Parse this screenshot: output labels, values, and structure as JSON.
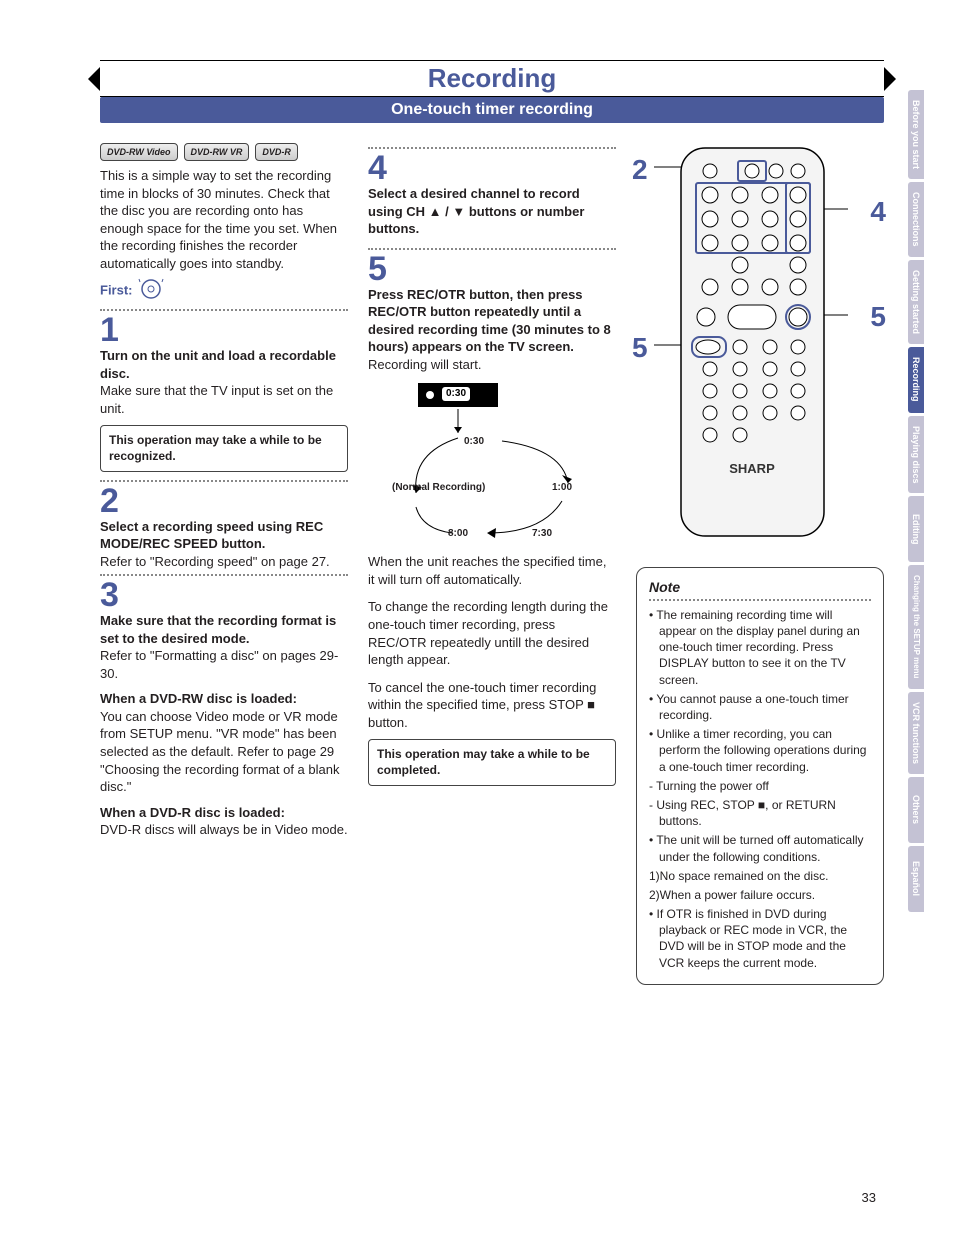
{
  "header": {
    "title": "Recording",
    "subtitle": "One-touch timer recording"
  },
  "badges": [
    "DVD-RW Video",
    "DVD-RW VR",
    "DVD-R"
  ],
  "intro": "This is a simple way to set the recording time in blocks of 30 minutes. Check that the disc you are recording onto has enough space for the time you set. When the recording finishes the recorder automatically goes into standby.",
  "first_label": "First:",
  "steps": {
    "s1": {
      "num": "1",
      "head": "Turn on the unit and load a recordable disc.",
      "body": "Make sure that the TV input is set on the unit.",
      "note": "This operation may take a while to be recognized."
    },
    "s2": {
      "num": "2",
      "head": "Select a recording speed using REC MODE/REC SPEED button.",
      "body": "Refer to \"Recording speed\" on page 27."
    },
    "s3": {
      "num": "3",
      "head": "Make sure that the recording format is set to the desired mode.",
      "body": "Refer to \"Formatting a disc\" on pages 29-30.",
      "rw_head": "When a DVD-RW disc is loaded:",
      "rw_body": "You can choose Video mode or VR mode from SETUP menu. \"VR mode\" has been selected as the default. Refer to page 29 \"Choosing the recording format of a blank disc.\"",
      "r_head": "When a DVD-R disc is loaded:",
      "r_body": "DVD-R discs will always be in Video mode."
    },
    "s4": {
      "num": "4",
      "head": "Select a desired channel to record using CH ▲ / ▼ buttons or number buttons."
    },
    "s5": {
      "num": "5",
      "head": "Press REC/OTR button, then press REC/OTR button repeatedly until a desired recording time (30 minutes to 8 hours) appears on the TV screen.",
      "body": "Recording will start."
    }
  },
  "diagram": {
    "osd": "0:30",
    "t030": "0:30",
    "normal": "(Normal Recording)",
    "t100": "1:00",
    "t800": "8:00",
    "t730": "7:30"
  },
  "after": {
    "p1": "When the unit reaches the specified time, it will turn off automatically.",
    "p2": "To change the recording length during the one-touch timer recording, press REC/OTR repeatedly untill the desired length appear.",
    "p3": "To cancel the one-touch timer recording within the specified time, press STOP ■ button.",
    "note": "This operation may take a while to be completed."
  },
  "callouts": {
    "c2": "2",
    "c4": "4",
    "c5a": "5",
    "c5b": "5"
  },
  "remote_brand": "SHARP",
  "note_box": {
    "hdr": "Note",
    "items": [
      "• The remaining recording time will appear on the display panel during an one-touch timer recording. Press DISPLAY button to see it on the TV screen.",
      "• You cannot pause a one-touch timer recording.",
      "• Unlike a timer recording, you can perform the following operations during a one-touch timer recording.",
      "  - Turning the power off",
      "  - Using REC, STOP ■, or RETURN buttons.",
      "• The unit will be turned off automatically under the following conditions.",
      "  1)No space remained on the disc.",
      "  2)When a power failure occurs.",
      "• If OTR is finished in DVD during playback or REC mode in VCR, the DVD will be in STOP mode and the VCR keeps the current mode."
    ]
  },
  "tabs": [
    "Before you start",
    "Connections",
    "Getting started",
    "Recording",
    "Playing discs",
    "Editing",
    "Changing the SETUP menu",
    "VCR functions",
    "Others",
    "Español"
  ],
  "active_tab_index": 3,
  "page_number": "33"
}
